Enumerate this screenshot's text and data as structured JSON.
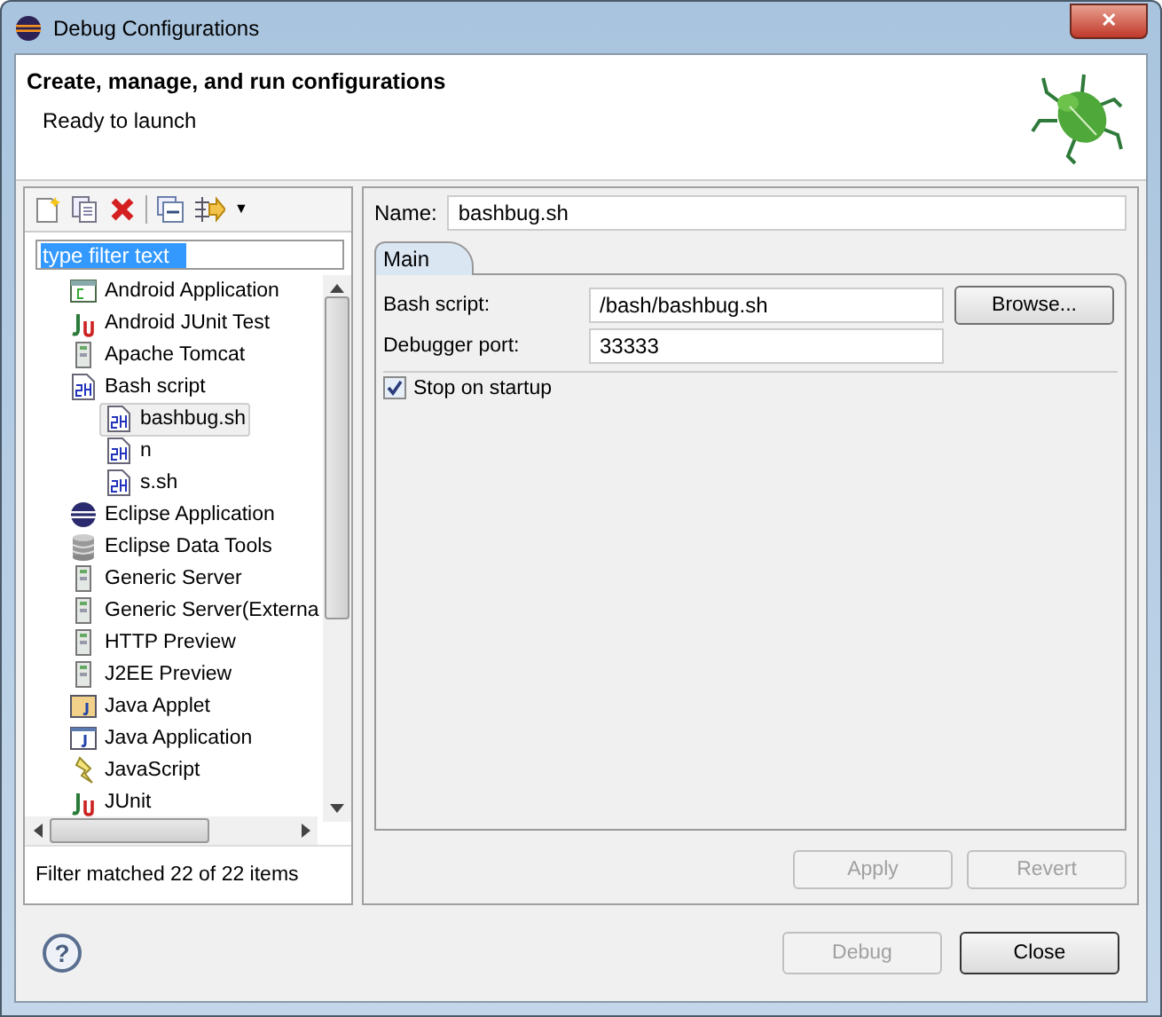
{
  "window": {
    "title": "Debug Configurations",
    "close": "✕"
  },
  "header": {
    "title": "Create, manage, and run configurations",
    "message": "Ready to launch"
  },
  "toolbar": {
    "menu": "▼"
  },
  "filter": {
    "value": "type filter text"
  },
  "tree": [
    {
      "label": "Android Application",
      "kind": "android",
      "selected": false
    },
    {
      "label": "Android JUnit Test",
      "kind": "junit",
      "selected": false
    },
    {
      "label": "Apache Tomcat",
      "kind": "server",
      "selected": false
    },
    {
      "label": "Bash script",
      "kind": "script",
      "selected": false,
      "children": [
        {
          "label": "bashbug.sh",
          "kind": "script",
          "selected": true
        },
        {
          "label": "n",
          "kind": "script",
          "selected": false
        },
        {
          "label": "s.sh",
          "kind": "script",
          "selected": false
        }
      ]
    },
    {
      "label": "Eclipse Application",
      "kind": "eclipse",
      "selected": false
    },
    {
      "label": "Eclipse Data Tools",
      "kind": "database",
      "selected": false
    },
    {
      "label": "Generic Server",
      "kind": "server",
      "selected": false
    },
    {
      "label": "Generic Server(Externa",
      "kind": "server",
      "selected": false
    },
    {
      "label": "HTTP Preview",
      "kind": "server",
      "selected": false
    },
    {
      "label": "J2EE Preview",
      "kind": "server",
      "selected": false
    },
    {
      "label": "Java Applet",
      "kind": "applet",
      "selected": false
    },
    {
      "label": "Java Application",
      "kind": "java",
      "selected": false
    },
    {
      "label": "JavaScript",
      "kind": "javascript",
      "selected": false
    },
    {
      "label": "JUnit",
      "kind": "junit",
      "selected": false
    }
  ],
  "filter_status": "Filter matched 22 of 22 items",
  "name": {
    "label": "Name:",
    "value": "bashbug.sh"
  },
  "tabs": [
    {
      "label": "Main",
      "selected": true
    }
  ],
  "fields": [
    {
      "label": "Bash script:",
      "value": "/bash/bashbug.sh"
    },
    {
      "label": "Debugger port:",
      "value": "33333"
    }
  ],
  "browse": "Browse...",
  "stop_on_startup": {
    "label": "Stop on startup",
    "checked": true
  },
  "apply": {
    "label": "Apply",
    "disabled": true
  },
  "revert": {
    "label": "Revert",
    "disabled": true
  },
  "help": "?",
  "debug": {
    "label": "Debug",
    "disabled": true
  },
  "close": {
    "label": "Close",
    "disabled": false
  }
}
